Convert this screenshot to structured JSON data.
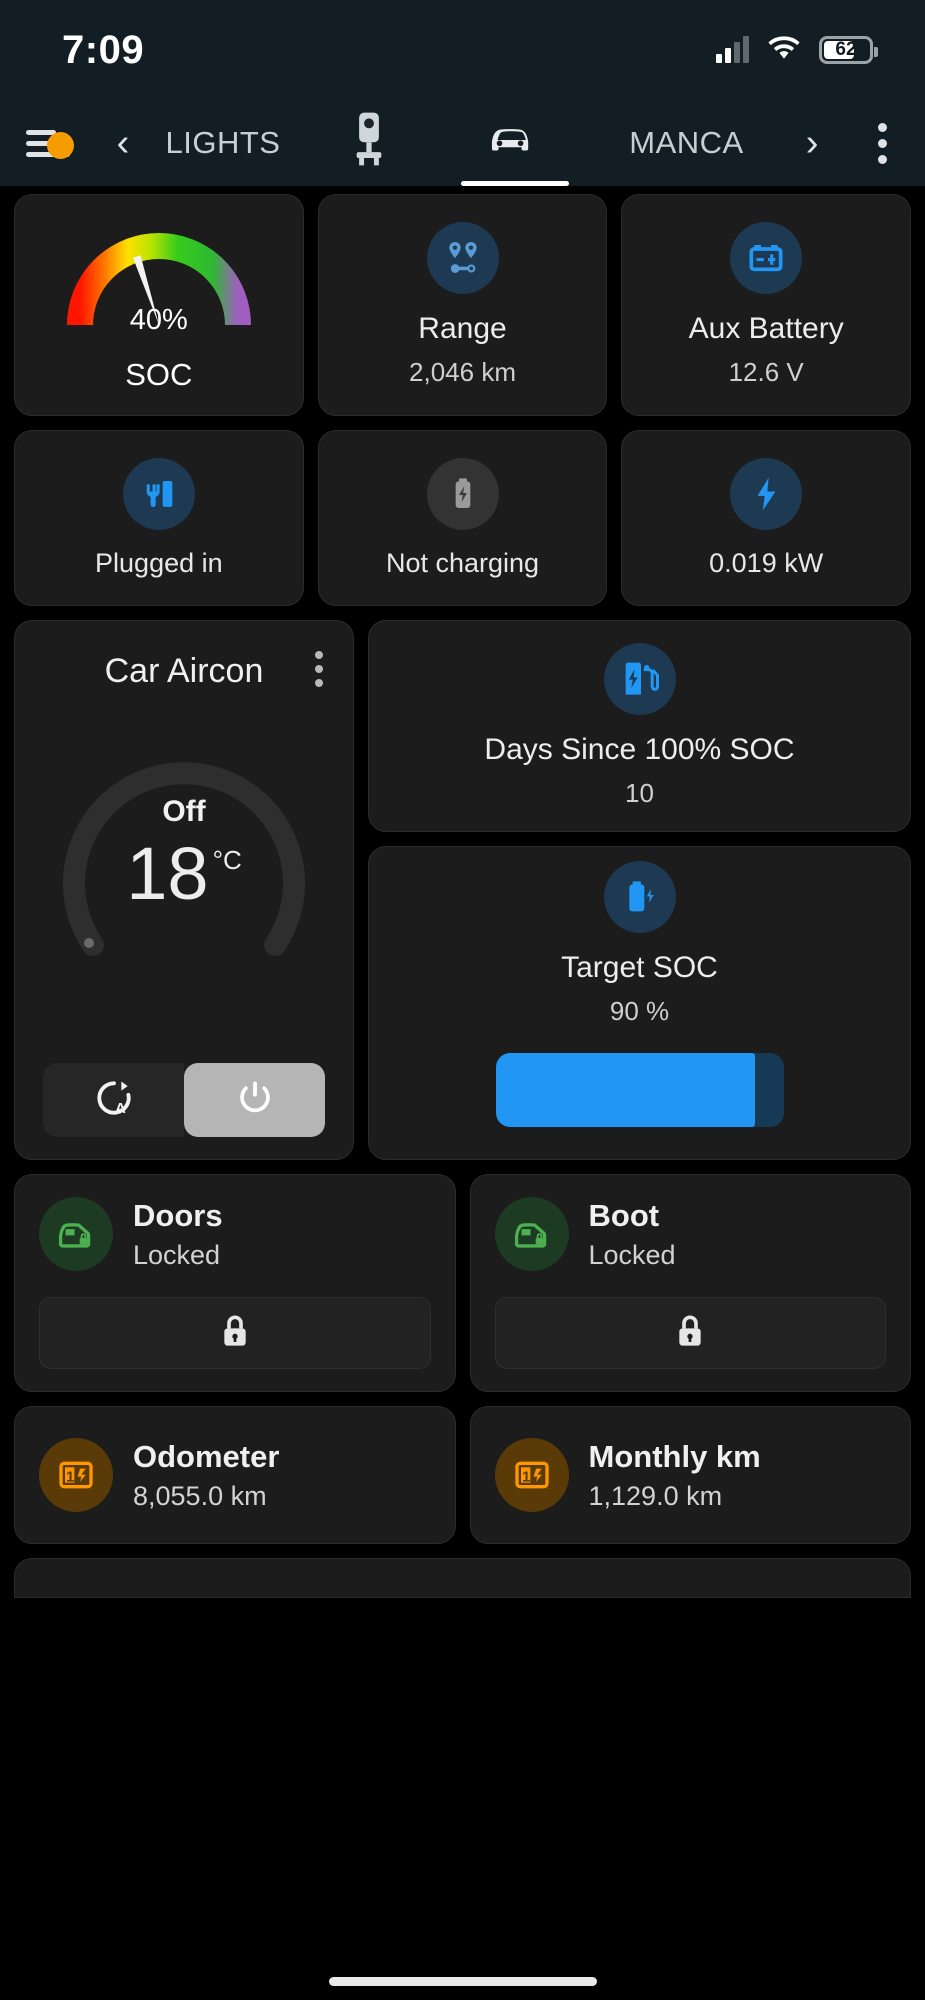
{
  "status_bar": {
    "time": "7:09",
    "battery_percent": "62",
    "icons": [
      "cellular-signal-icon",
      "wifi-icon",
      "battery-icon"
    ]
  },
  "toolbar": {
    "menu_icon": "hamburger-menu-icon",
    "notification_dot": true,
    "prev_arrow": "‹",
    "next_arrow": "›",
    "prev_tab_label": "LIGHTS",
    "next_tab_label": "MANCA",
    "tabs": [
      {
        "label": "",
        "icon": "charger-icon",
        "active": false
      },
      {
        "label": "",
        "icon": "car-icon",
        "active": true
      }
    ],
    "overflow_icon": "kebab-menu-icon"
  },
  "row1": {
    "soc": {
      "value_label": "40%",
      "name": "SOC",
      "percent": 40,
      "gauge_colors": [
        "#ff1f00",
        "#ffd000",
        "#8ee000",
        "#12c612",
        "#9b59b6"
      ]
    },
    "range": {
      "icon": "route-pins-icon",
      "title": "Range",
      "value": "2,046 km"
    },
    "aux_battery": {
      "icon": "car-battery-icon",
      "title": "Aux Battery",
      "value": "12.6 V"
    }
  },
  "row2": {
    "plugged": {
      "icon": "ev-plug-icon",
      "label": "Plugged in",
      "active": true
    },
    "charging": {
      "icon": "battery-bolt-icon",
      "label": "Not charging",
      "active": false
    },
    "power": {
      "icon": "lightning-bolt-icon",
      "label": "0.019 kW",
      "active": true
    }
  },
  "aircon": {
    "title": "Car Aircon",
    "menu_icon": "kebab-menu-icon",
    "state": "Off",
    "temperature": "18",
    "unit": "°C",
    "auto_button_icon": "auto-mode-icon",
    "power_button_icon": "power-icon"
  },
  "days_since": {
    "icon": "ev-charging-station-icon",
    "title": "Days Since 100% SOC",
    "value": "10"
  },
  "target_soc": {
    "icon": "battery-charge-icon",
    "title": "Target SOC",
    "value": "90 %",
    "percent": 90,
    "bar_color": "#2196f3",
    "bar_track_color": "#163955"
  },
  "locks": [
    {
      "icon": "car-door-lock-icon",
      "name": "Doors",
      "state": "Locked",
      "button_icon": "padlock-icon"
    },
    {
      "icon": "car-boot-lock-icon",
      "name": "Boot",
      "state": "Locked",
      "button_icon": "padlock-icon"
    }
  ],
  "odometers": [
    {
      "icon": "counter-icon",
      "name": "Odometer",
      "value": "8,055.0 km"
    },
    {
      "icon": "counter-icon",
      "name": "Monthly km",
      "value": "1,129.0 km"
    }
  ]
}
